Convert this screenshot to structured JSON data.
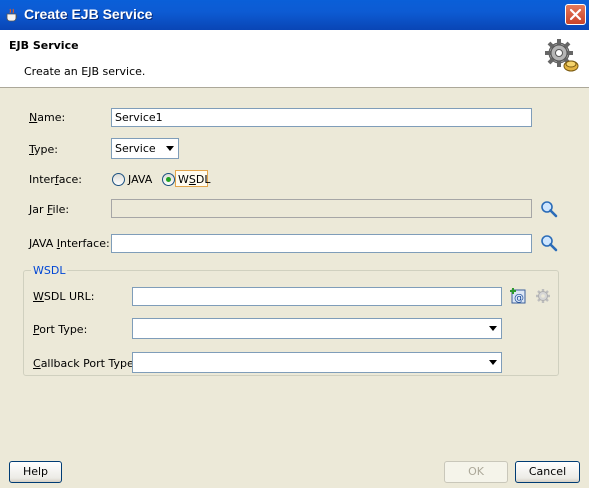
{
  "window": {
    "title": "Create EJB Service"
  },
  "header": {
    "title": "EJB Service",
    "description": "Create an EJB service."
  },
  "form": {
    "name": {
      "label_prefix": "",
      "label_mnemonic": "N",
      "label_rest": "ame:",
      "value": "Service1"
    },
    "type": {
      "label_mnemonic": "T",
      "label_rest": "ype:",
      "value": "Service"
    },
    "interface": {
      "label_before": "Inter",
      "label_mnemonic": "f",
      "label_after": "ace:",
      "options": [
        {
          "label_mnemonic": "J",
          "label_rest": "AVA",
          "checked": false
        },
        {
          "label_before": "W",
          "label_mnemonic": "S",
          "label_rest": "DL",
          "checked": true
        }
      ]
    },
    "jar_file": {
      "label_before": "Jar ",
      "label_mnemonic": "F",
      "label_rest": "ile:",
      "value": ""
    },
    "java_interface": {
      "label_before": "JAVA ",
      "label_mnemonic": "I",
      "label_rest": "nterface:",
      "value": ""
    },
    "wsdl_group": {
      "legend": "WSDL",
      "wsdl_url": {
        "label_mnemonic": "W",
        "label_rest": "SDL URL:",
        "value": ""
      },
      "port_type": {
        "label_mnemonic": "P",
        "label_rest": "ort Type:",
        "value": ""
      },
      "callback_port_type": {
        "label_mnemonic": "C",
        "label_rest": "allback Port Type:",
        "value": ""
      }
    }
  },
  "footer": {
    "help": "Help",
    "ok": "OK",
    "cancel": "Cancel"
  },
  "icons": {
    "app": "coffee-cup-icon",
    "close": "close-icon",
    "header": "gears-icon",
    "browse": "magnifier-icon",
    "wsdl_add": "add-wsdl-icon",
    "wsdl_gear": "gear-icon"
  },
  "colors": {
    "titlebar": "#0A5FD8",
    "dialog_bg": "#ECE9D8",
    "group_legend": "#0046D5",
    "focus_border": "#E3A54B"
  }
}
